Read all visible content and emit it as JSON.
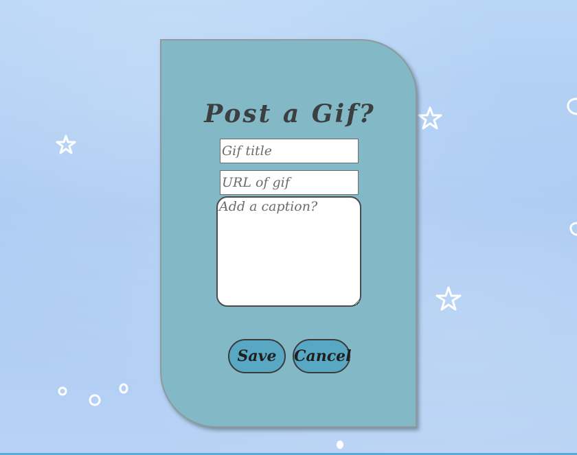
{
  "form": {
    "title": "Post a Gif?",
    "gif_title_placeholder": "Gif title",
    "gif_url_placeholder": "URL of gif",
    "caption_placeholder": "Add a caption?",
    "save_label": "Save",
    "cancel_label": "Cancel"
  },
  "background": {
    "doodles": [
      "star-doodle",
      "star-doodle",
      "star-doodle",
      "circle-doodle",
      "circle-doodle",
      "circle-doodle",
      "circle-doodle"
    ]
  },
  "colors": {
    "card": "#83b8c6",
    "button": "#58a8c4",
    "title_text": "#3b3f40",
    "background": "#b2cff4"
  }
}
